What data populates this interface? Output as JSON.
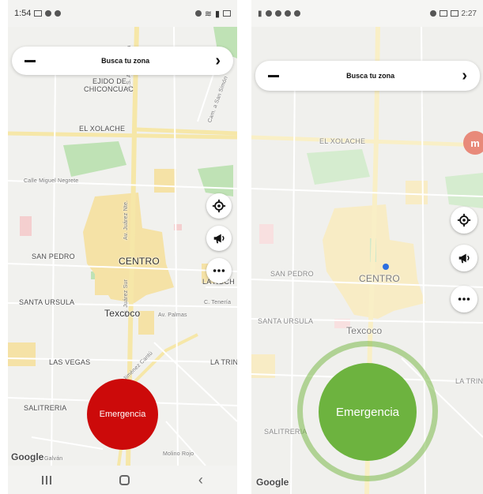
{
  "left_phone": {
    "status": {
      "time": "1:54"
    },
    "search": {
      "title": "Busca tu zona"
    },
    "map_labels": {
      "ejido": "EJIDO DE",
      "ejido2": "CHICONCUAC",
      "xolache": "EL XOLACHE",
      "miguel": "Calle Miguel Negrete",
      "andres": "A.S. Andrés Chia",
      "simon": "Cam. a San Simón",
      "sanpedro": "SAN PEDRO",
      "centro": "CENTRO",
      "lanoch": "LA NOCH",
      "santaursula": "SANTA URSULA",
      "texcoco": "Texcoco",
      "palmas": "Av. Palmas",
      "lasvegas": "LAS VEGAS",
      "latrin": "LA TRIN",
      "salitreria": "SALITRERIA",
      "juarez_sur": "Av. Juárez Sur",
      "juarez_nte": "Av. Juárez Nte.",
      "teneria": "C. Tenería",
      "galvan": "Galván",
      "molino": "Molino Rojo",
      "jimenez": "Jiménez Cantú"
    },
    "emergency_label": "Emergencia",
    "google": "Google"
  },
  "right_phone": {
    "status": {
      "time": "2:27"
    },
    "search": {
      "title": "Busca tu zona"
    },
    "map_labels": {
      "xolache": "EL XOLACHE",
      "sanpedro": "SAN PEDRO",
      "centro": "CENTRO",
      "santaursula": "SANTA URSULA",
      "texcoco": "Texcoco",
      "latrin": "LA TRIN",
      "salitreria": "SALITRERIA"
    },
    "m_badge": "m",
    "emergency_label": "Emergencia",
    "google": "Google"
  },
  "colors": {
    "emergency_red": "#cc0a0a",
    "emergency_green": "#6db33f",
    "road_yellow": "#f6e7a8",
    "urban": "#f5e2a6",
    "park": "#bfe2b5"
  },
  "icons": [
    "target-icon",
    "megaphone-icon",
    "more-icon",
    "chevron-right-icon",
    "minus-icon"
  ]
}
